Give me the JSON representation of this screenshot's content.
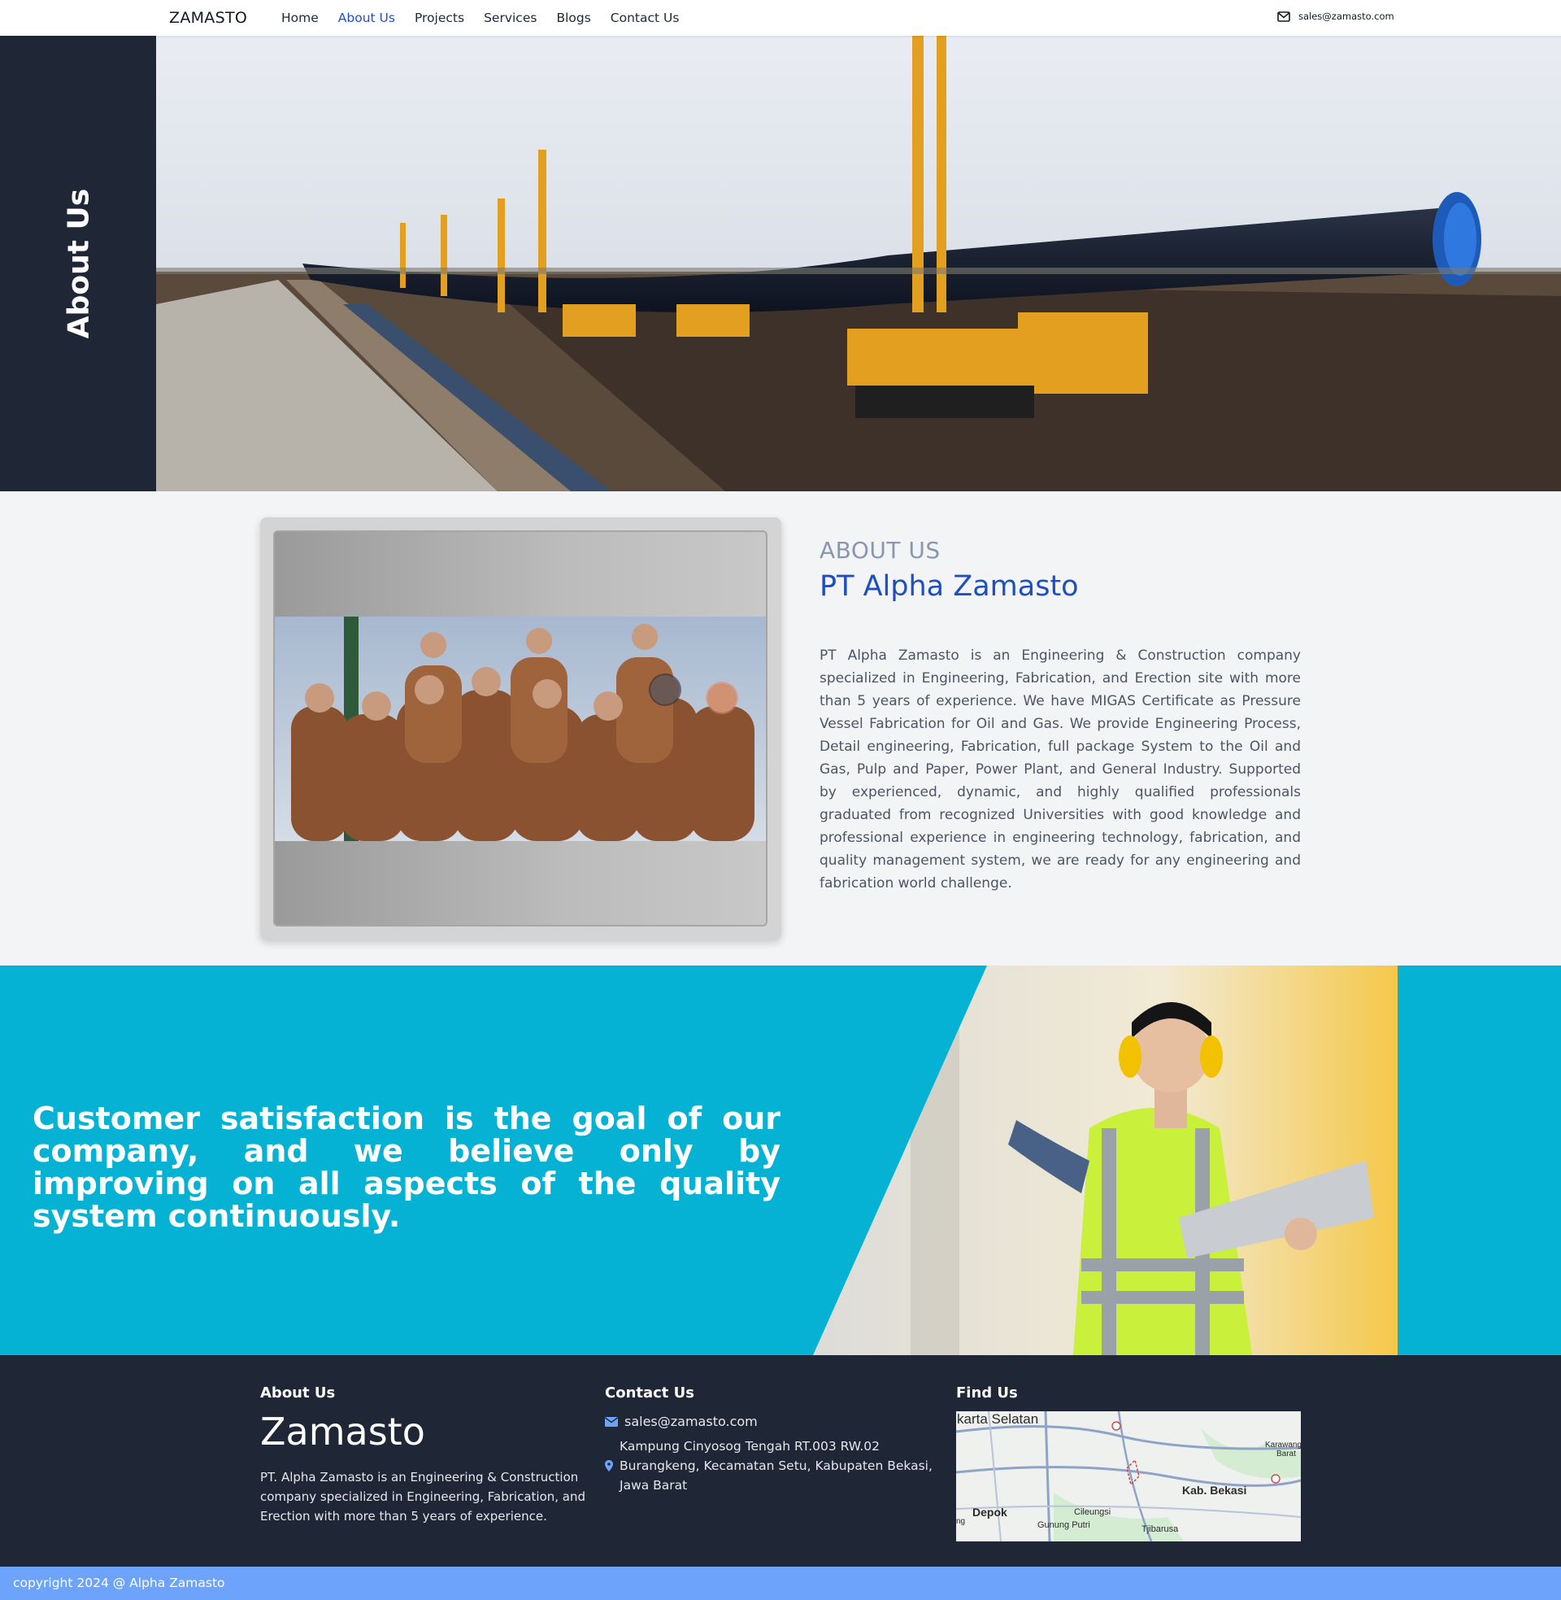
{
  "nav": {
    "brand": "ZAMASTO",
    "links": [
      {
        "label": "Home",
        "active": false
      },
      {
        "label": "About Us",
        "active": true
      },
      {
        "label": "Projects",
        "active": false
      },
      {
        "label": "Services",
        "active": false
      },
      {
        "label": "Blogs",
        "active": false
      },
      {
        "label": "Contact Us",
        "active": false
      }
    ],
    "email": "sales@zamasto.com",
    "email_icon": "mail-icon"
  },
  "hero": {
    "title": "About Us",
    "image": "pipeline-construction-photo"
  },
  "about": {
    "kicker": "ABOUT US",
    "title": "PT Alpha Zamasto",
    "image": "team-photo",
    "description": "PT Alpha Zamasto is an Engineering & Construction company specialized in Engineering, Fabrication, and Erection site with more than 5 years of experience. We have MIGAS Certificate as Pressure Vessel Fabrication for Oil and Gas. We provide Engineering Process, Detail engineering, Fabrication, full package System to the Oil and Gas, Pulp and Paper, Power Plant, and General Industry. Supported by experienced, dynamic, and highly qualified professionals graduated from recognized Universities with good knowledge and professional experience in engineering technology, fabrication, and quality management system, we are ready for any engineering and fabrication world challenge."
  },
  "banner": {
    "text": "Customer satisfaction is the goal of our company, and we believe only by improving on all aspects of the quality system continuously.",
    "image": "engineer-with-laptop-photo",
    "color": "#06b2d4"
  },
  "footer": {
    "about_heading": "About Us",
    "brand": "Zamasto",
    "description": "PT. Alpha Zamasto is an Engineering & Construction company specialized in Engineering, Fabrication, and Erection with more than 5 years of experience.",
    "contact_heading": "Contact Us",
    "email": "sales@zamasto.com",
    "address": "Kampung Cinyosog Tengah RT.003 RW.02 Burangkeng, Kecamatan Setu, Kabupaten Bekasi, Jawa Barat",
    "find_heading": "Find Us",
    "map_labels": {
      "a": "karta Selatan",
      "b": "Karawang",
      "b2": "Barat",
      "c": "Kab. Bekasi",
      "d": "Depok",
      "e": "Cileungsi",
      "f": "Gunung Putri",
      "g": "Tjibarusa",
      "h": "ng"
    }
  },
  "copyright": "copyright 2024 @ Alpha Zamasto",
  "colors": {
    "accent": "#1d4ed8",
    "dark": "#1f2636",
    "copyright_bar": "#6ea3fb"
  }
}
